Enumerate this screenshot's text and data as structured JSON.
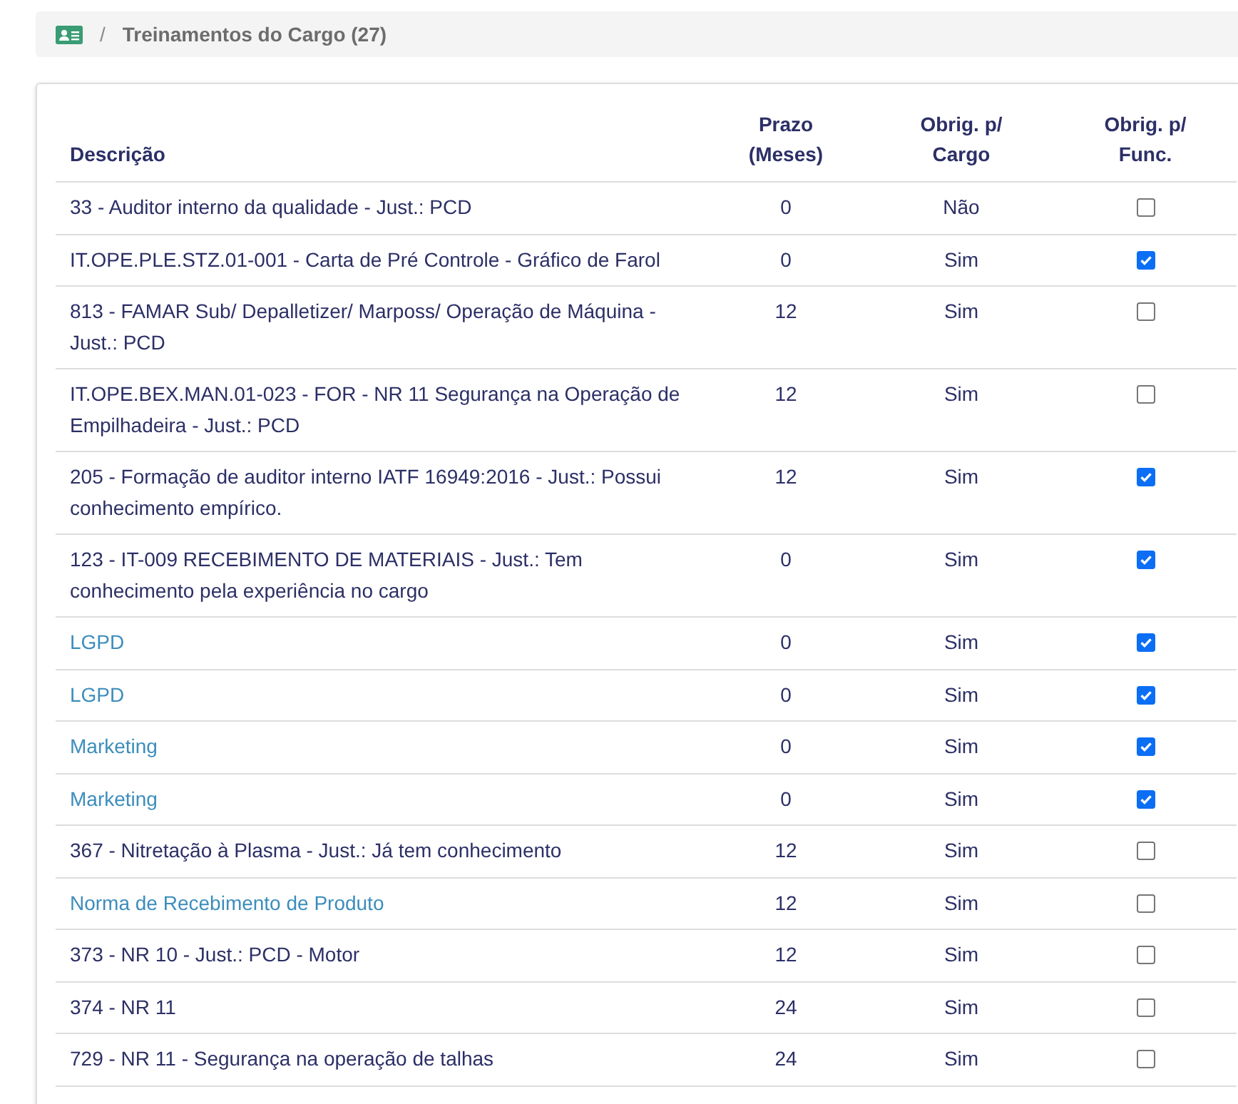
{
  "breadcrumb": {
    "separator": "/",
    "title": "Treinamentos do Cargo (27)"
  },
  "table": {
    "columns": [
      "Descrição",
      "Prazo (Meses)",
      "Obrig. p/ Cargo",
      "Obrig. p/ Func."
    ],
    "rows": [
      {
        "kind": "text",
        "description": "33 - Auditor interno da qualidade - Just.: PCD",
        "prazo": "0",
        "obrig_cargo": "Não",
        "checked": false
      },
      {
        "kind": "text",
        "description": "IT.OPE.PLE.STZ.01-001 - Carta de Pré Controle - Gráfico de Farol",
        "prazo": "0",
        "obrig_cargo": "Sim",
        "checked": true
      },
      {
        "kind": "text",
        "description": "813 - FAMAR Sub/ Depalletizer/ Marposs/ Operação de Máquina - Just.: PCD",
        "prazo": "12",
        "obrig_cargo": "Sim",
        "checked": false
      },
      {
        "kind": "text",
        "description": "IT.OPE.BEX.MAN.01-023 - FOR - NR 11 Segurança na Operação de Empilhadeira - Just.: PCD",
        "prazo": "12",
        "obrig_cargo": "Sim",
        "checked": false
      },
      {
        "kind": "text",
        "description": "205 - Formação de auditor interno IATF 16949:2016 - Just.: Possui conhecimento empírico.",
        "prazo": "12",
        "obrig_cargo": "Sim",
        "checked": true
      },
      {
        "kind": "text",
        "description": "123 - IT-009 RECEBIMENTO DE MATERIAIS - Just.: Tem conhecimento pela experiência no cargo",
        "prazo": "0",
        "obrig_cargo": "Sim",
        "checked": true
      },
      {
        "kind": "link",
        "description": "LGPD",
        "prazo": "0",
        "obrig_cargo": "Sim",
        "checked": true
      },
      {
        "kind": "link",
        "description": "LGPD",
        "prazo": "0",
        "obrig_cargo": "Sim",
        "checked": true
      },
      {
        "kind": "link",
        "description": "Marketing",
        "prazo": "0",
        "obrig_cargo": "Sim",
        "checked": true
      },
      {
        "kind": "link",
        "description": "Marketing",
        "prazo": "0",
        "obrig_cargo": "Sim",
        "checked": true
      },
      {
        "kind": "text",
        "description": "367 - Nitretação à Plasma - Just.: Já tem conhecimento",
        "prazo": "12",
        "obrig_cargo": "Sim",
        "checked": false
      },
      {
        "kind": "link",
        "description": "Norma de Recebimento de Produto",
        "prazo": "12",
        "obrig_cargo": "Sim",
        "checked": false
      },
      {
        "kind": "text",
        "description": "373 - NR 10 - Just.: PCD - Motor",
        "prazo": "12",
        "obrig_cargo": "Sim",
        "checked": false
      },
      {
        "kind": "text",
        "description": "374 - NR 11",
        "prazo": "24",
        "obrig_cargo": "Sim",
        "checked": false
      },
      {
        "kind": "text",
        "description": "729 - NR 11 - Segurança na operação de talhas",
        "prazo": "24",
        "obrig_cargo": "Sim",
        "checked": false
      }
    ]
  }
}
